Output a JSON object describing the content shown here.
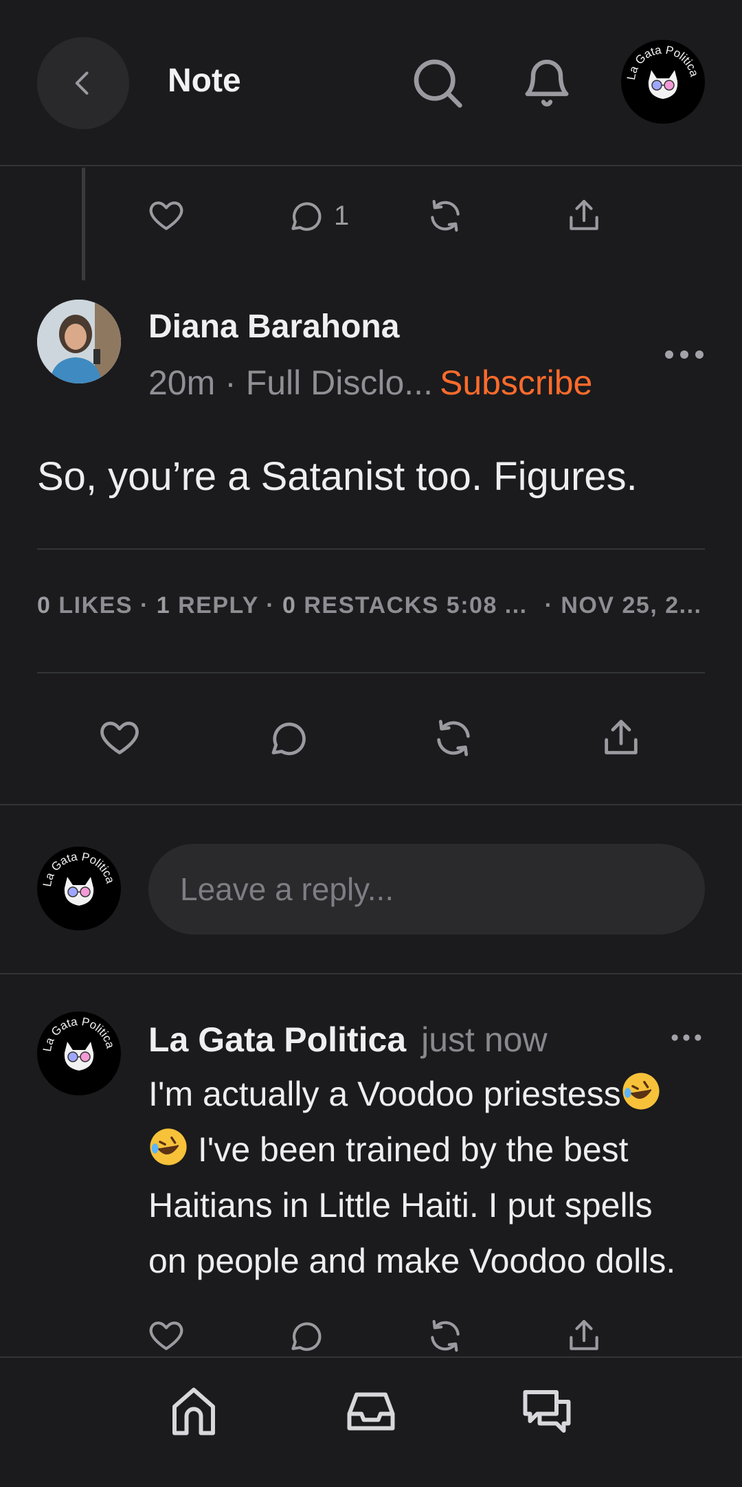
{
  "header": {
    "title": "Note",
    "profile_logo_text": "La Gata Politica"
  },
  "parent_actions": {
    "reply_count": "1"
  },
  "post": {
    "author": "Diana Barahona",
    "time": "20m",
    "separator": " · ",
    "publication": "Full Disclo...",
    "subscribe_label": "Subscribe",
    "body": "So, you’re a Satanist too. Figures.",
    "stats": {
      "likes_count": "0",
      "likes_label": "LIKES",
      "replies_count": "1",
      "replies_label": "REPLY",
      "restacks_count": "0",
      "restacks_label": "RESTACKS",
      "time": "5:08 ...",
      "date": "NOV 25, 2...",
      "dot": "·"
    }
  },
  "reply_box": {
    "placeholder": "Leave a reply..."
  },
  "comment": {
    "author": "La Gata Politica",
    "time": "just now",
    "body_part1": "I'm actually a Voodoo priestess",
    "body_part2": " I've been trained by the best Haitians in Little Haiti. I put spells on people and make Voodoo dolls."
  },
  "icons": {
    "back": "chevron-left-icon",
    "search": "search-icon",
    "notifications": "bell-icon",
    "like": "heart-icon",
    "comment": "comment-bubble-icon",
    "restack": "restack-icon",
    "share": "share-icon",
    "more": "more-dots-icon",
    "home": "home-icon",
    "inbox": "inbox-icon",
    "chat": "chat-icon"
  },
  "colors": {
    "background": "#1b1b1d",
    "accent": "#ff6b2c",
    "muted": "#8f8f95"
  }
}
